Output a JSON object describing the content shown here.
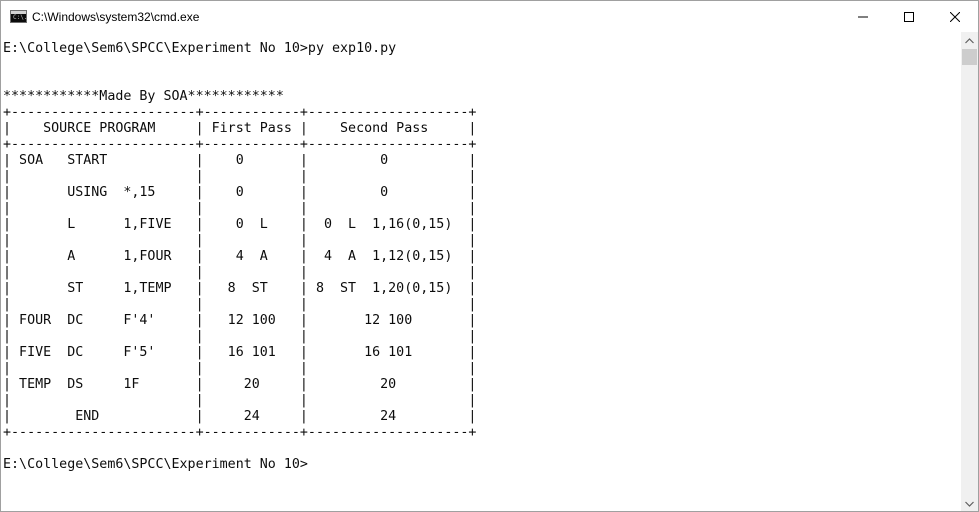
{
  "window": {
    "title": "C:\\Windows\\system32\\cmd.exe",
    "icon": "cmd-icon",
    "icon_glyph": "C:\\."
  },
  "controls": {
    "minimize_icon": "minimize-icon",
    "maximize_icon": "maximize-icon",
    "close_icon": "close-icon"
  },
  "console": {
    "lines": [
      "E:\\College\\Sem6\\SPCC\\Experiment No 10>py exp10.py",
      "",
      "",
      "************Made By SOA************",
      "+-----------------------+------------+--------------------+",
      "|    SOURCE PROGRAM     | First Pass |    Second Pass     |",
      "+-----------------------+------------+--------------------+",
      "| SOA   START           |    0       |         0          |",
      "|                       |            |                    |",
      "|       USING  *,15     |    0       |         0          |",
      "|                       |            |                    |",
      "|       L      1,FIVE   |    0  L    |  0  L  1,16(0,15)  |",
      "|                       |            |                    |",
      "|       A      1,FOUR   |    4  A    |  4  A  1,12(0,15)  |",
      "|                       |            |                    |",
      "|       ST     1,TEMP   |   8  ST    | 8  ST  1,20(0,15)  |",
      "|                       |            |                    |",
      "| FOUR  DC     F'4'     |   12 100   |       12 100       |",
      "|                       |            |                    |",
      "| FIVE  DC     F'5'     |   16 101   |       16 101       |",
      "|                       |            |                    |",
      "| TEMP  DS     1F       |     20     |         20         |",
      "|                       |            |                    |",
      "|        END            |     24     |         24         |",
      "+-----------------------+------------+--------------------+",
      "",
      "E:\\College\\Sem6\\SPCC\\Experiment No 10>"
    ]
  },
  "scrollbar": {
    "up_icon": "scroll-up-arrow-icon",
    "down_icon": "scroll-down-arrow-icon"
  },
  "colors": {
    "console_bg": "#ffffff",
    "console_fg": "#0c0c0c",
    "titlebar_bg": "#ffffff"
  }
}
